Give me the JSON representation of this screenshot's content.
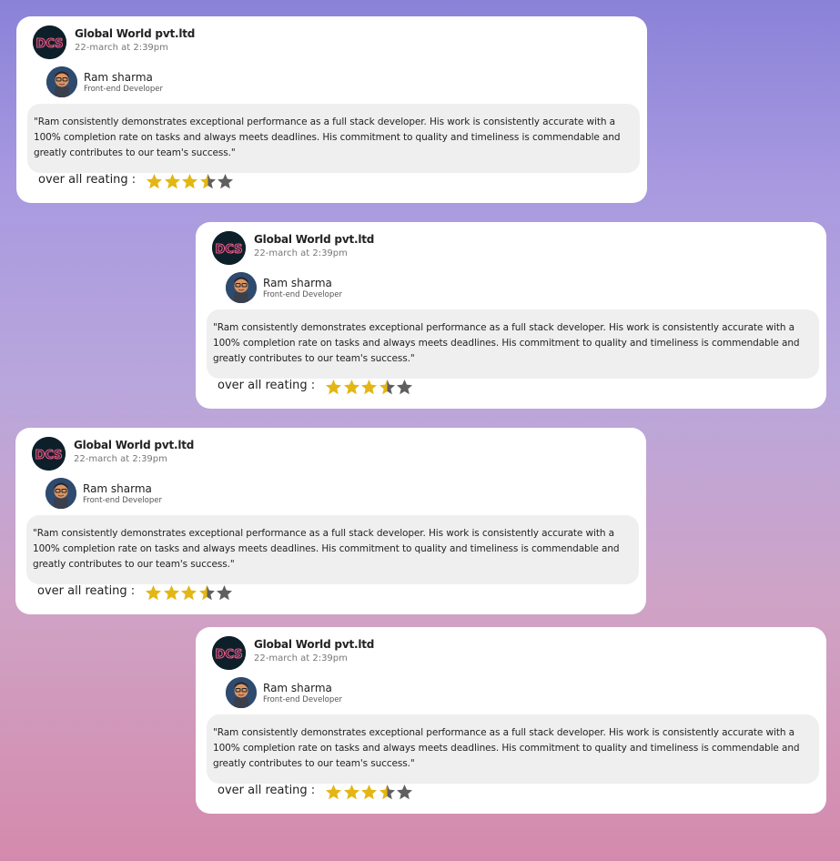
{
  "colors": {
    "star_filled": "#e3b614",
    "star_empty": "#5f5f5f",
    "card_bg": "#ffffff",
    "review_bg": "#efefef"
  },
  "reviews": [
    {
      "company": "Global World pvt.ltd",
      "time": "22-march at 2:39pm",
      "reviewer_name": "Ram sharma",
      "reviewer_role": "Front-end Developer",
      "text": "\"Ram consistently demonstrates exceptional performance as a full stack developer. His work is consistently accurate with a 100% completion rate on tasks and always meets deadlines. His commitment to quality and timeliness is commendable and greatly contributes to our team's success.\"",
      "rating_label": "over all reating :",
      "rating": 3.5
    },
    {
      "company": "Global World pvt.ltd",
      "time": "22-march at 2:39pm",
      "reviewer_name": "Ram sharma",
      "reviewer_role": "Front-end Developer",
      "text": "\"Ram consistently demonstrates exceptional performance as a full stack developer. His work is consistently accurate with a 100% completion rate on tasks and always meets deadlines. His commitment to quality and timeliness is commendable and greatly contributes to our team's success.\"",
      "rating_label": "over all reating :",
      "rating": 3.5
    },
    {
      "company": "Global World pvt.ltd",
      "time": "22-march at 2:39pm",
      "reviewer_name": "Ram sharma",
      "reviewer_role": "Front-end Developer",
      "text": "\"Ram consistently demonstrates exceptional performance as a full stack developer. His work is consistently accurate with a 100% completion rate on tasks and always meets deadlines. His commitment to quality and timeliness is commendable and greatly contributes to our team's success.\"",
      "rating_label": "over all reating :",
      "rating": 3.5
    },
    {
      "company": "Global World pvt.ltd",
      "time": "22-march at 2:39pm",
      "reviewer_name": "Ram sharma",
      "reviewer_role": "Front-end Developer",
      "text": "\"Ram consistently demonstrates exceptional performance as a full stack developer. His work is consistently accurate with a 100% completion rate on tasks and always meets deadlines. His commitment to quality and timeliness is commendable and greatly contributes to our team's success.\"",
      "rating_label": "over all reating :",
      "rating": 3.5
    }
  ]
}
